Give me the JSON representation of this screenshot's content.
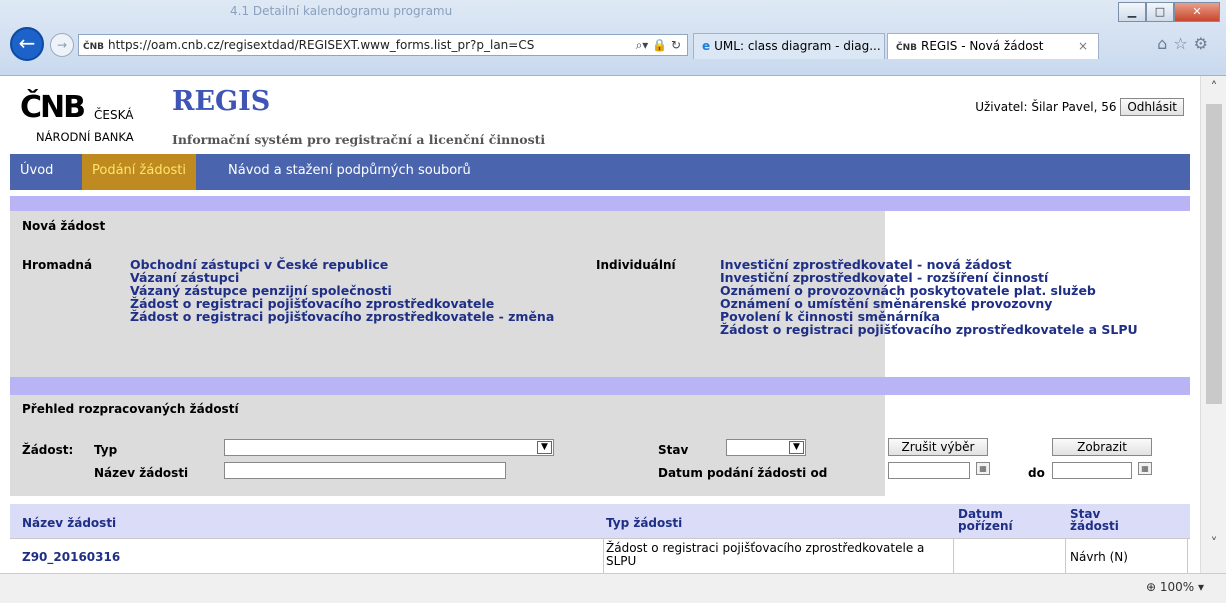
{
  "browser": {
    "ghost_title": "4.1   Detailní kalendogramu programu",
    "url": "https://oam.cnb.cz/regisextdad/REGISEXT.www_forms.list_pr?p_lan=CS",
    "tabs": [
      {
        "label": "UML: class diagram - diag..."
      },
      {
        "label": "REGIS - Nová žádost"
      }
    ],
    "zoom": "100%"
  },
  "header": {
    "logo_big": "ČNB",
    "logo_small": "ČESKÁ",
    "logo_bottom": "NÁRODNÍ BANKA",
    "title": "REGIS",
    "subtitle": "Informační systém pro registrační a licenční činnosti",
    "user_label": "Uživatel: Šilar Pavel, 56",
    "logout_label": "Odhlásit"
  },
  "menu": {
    "items": [
      {
        "label": "Úvod"
      },
      {
        "label": "Podání žádosti"
      },
      {
        "label": "Návod a stažení podpůrných souborů"
      }
    ]
  },
  "new_request": {
    "title": "Nová žádost",
    "bulk_label": "Hromadná",
    "bulk_links": [
      "Obchodní zástupci v České republice",
      "Vázaní zástupci",
      "Vázaný zástupce penzijní společnosti",
      "Žádost o registraci pojišťovacího zprostředkovatele",
      "Žádost o registraci pojišťovacího zprostředkovatele - změna"
    ],
    "individual_label": "Individuální",
    "individual_links": [
      "Investiční zprostředkovatel - nová žádost",
      "Investiční zprostředkovatel - rozšíření činností",
      "Oznámení o provozovnách poskytovatele plat. služeb",
      "Oznámení o umístění směnárenské provozovny",
      "Povolení k činnosti směnárníka",
      "Žádost o registraci pojišťovacího zprostředkovatele a SLPU"
    ]
  },
  "overview": {
    "title": "Přehled rozpracovaných žádostí",
    "request_label": "Žádost:",
    "type_label": "Typ",
    "name_label": "Název žádosti",
    "state_label": "Stav",
    "date_from_label": "Datum podání žádosti od",
    "date_to_label": "do",
    "clear_button": "Zrušit výběr",
    "show_button": "Zobrazit"
  },
  "table": {
    "headers": [
      "Název žádosti",
      "Typ žádosti",
      "Datum pořízení",
      "Stav žádosti"
    ],
    "rows": [
      {
        "name": "Z90_20160316",
        "type": "Žádost o registraci pojišťovacího zprostředkovatele a SLPU",
        "date": "",
        "state": "Návrh (N)"
      }
    ]
  }
}
